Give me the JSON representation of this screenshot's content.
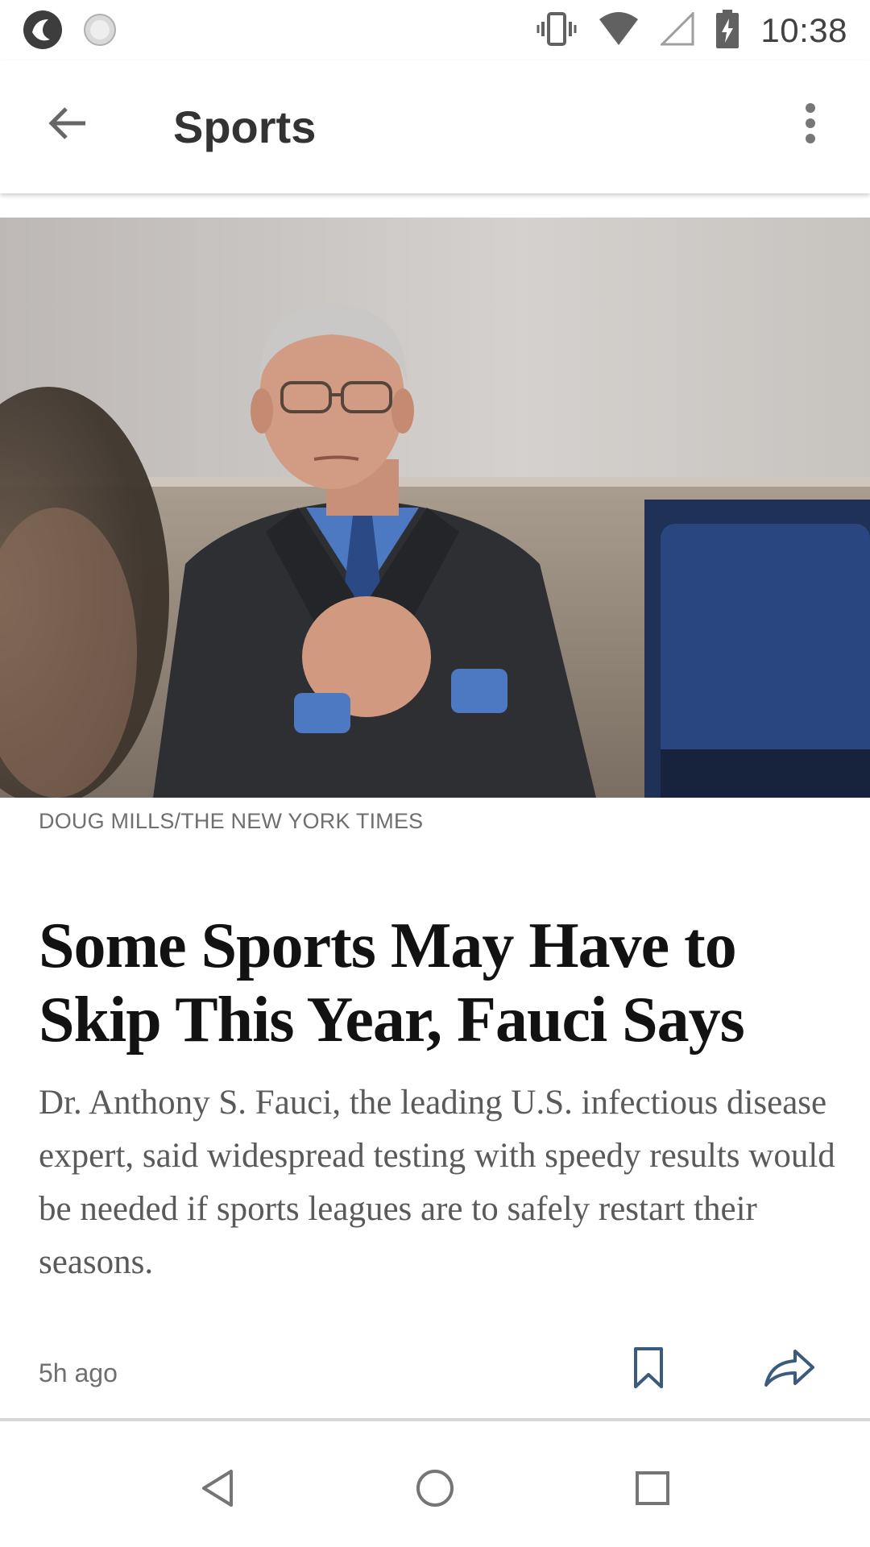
{
  "status_bar": {
    "time": "10:38",
    "icons": [
      "app-logo-icon",
      "loading-icon",
      "vibrate-icon",
      "wifi-icon",
      "cell-signal-icon",
      "battery-charging-icon"
    ]
  },
  "app_bar": {
    "title": "Sports",
    "back_icon": "arrow-back-icon",
    "more_icon": "more-vert-icon"
  },
  "article": {
    "photo_credit": "DOUG MILLS/THE NEW YORK TIMES",
    "headline": "Some Sports May Have to Skip This Year, Fauci Says",
    "summary": "Dr. Anthony S. Fauci, the leading U.S. infectious disease expert, said widespread testing with speedy results would be needed if sports leagues are to safely restart their seasons.",
    "timestamp": "5h ago",
    "bookmark_icon": "bookmark-icon",
    "share_icon": "share-icon"
  },
  "nav_bar": {
    "icons": [
      "nav-back-icon",
      "nav-home-icon",
      "nav-recents-icon"
    ]
  },
  "colors": {
    "accent_icon": "#3b5b7d",
    "title_text": "#333333",
    "headline_text": "#121212",
    "summary_text": "#5a5a5a",
    "meta_text": "#6f6f6f"
  }
}
